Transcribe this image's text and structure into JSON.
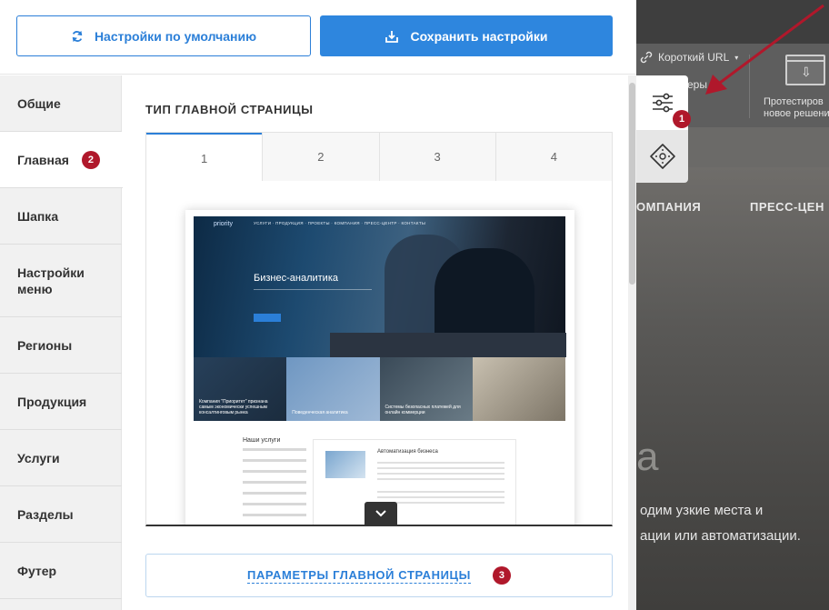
{
  "toolbar": {
    "reset_label": "Настройки по умолчанию",
    "save_label": "Сохранить настройки"
  },
  "sidebar": {
    "items": [
      {
        "label": "Общие"
      },
      {
        "label": "Главная",
        "badge": "2"
      },
      {
        "label": "Шапка"
      },
      {
        "label": "Настройки меню"
      },
      {
        "label": "Регионы"
      },
      {
        "label": "Продукция"
      },
      {
        "label": "Услуги"
      },
      {
        "label": "Разделы"
      },
      {
        "label": "Футер"
      }
    ]
  },
  "main": {
    "section_title": "ТИП ГЛАВНОЙ СТРАНИЦЫ",
    "tabs": [
      "1",
      "2",
      "3",
      "4"
    ],
    "preview": {
      "logo": "priority",
      "hero_title": "Бизнес-аналитика",
      "services_title": "Наши услуги",
      "box_title": "Автоматизация бизнеса",
      "cards": [
        "Компания \"Приоритет\" признана самым экономически успешным консалтинговым рынка",
        "Поведенческая аналитика",
        "",
        "Системы безопасных платежей для онлайн коммерции"
      ]
    },
    "params_label": "ПАРАМЕТРЫ ГЛАВНОЙ СТРАНИЦЫ",
    "params_badge": "3"
  },
  "tools": {
    "settings_badge": "1",
    "settings_icon": "sliders-icon",
    "nav_icon": "directions-icon"
  },
  "background": {
    "short_url": "Короткий URL",
    "ery": "еры",
    "test_label_1": "Протестиров",
    "test_label_2": "новое решени",
    "menu_1": "ОМПАНИЯ",
    "menu_2": "ПРЕСС-ЦЕН",
    "big_letter": "а",
    "text_1": "одим узкие места и",
    "text_2": "ации или автоматизации."
  },
  "colors": {
    "accent": "#2e86de",
    "badge": "#b0182b",
    "arrow": "#b0182b"
  }
}
